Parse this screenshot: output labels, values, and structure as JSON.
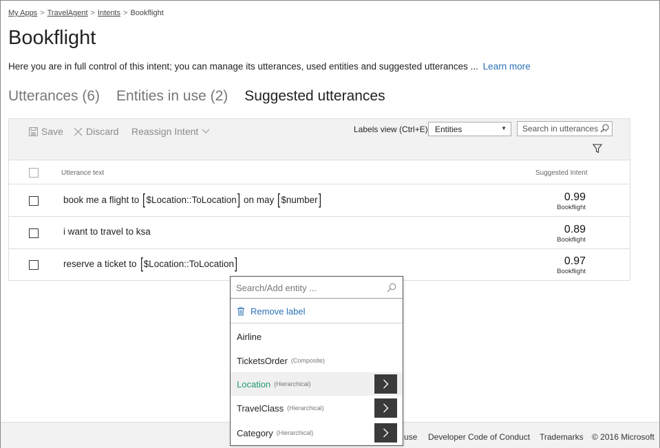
{
  "breadcrumb": [
    {
      "label": "My Apps",
      "link": true
    },
    {
      "label": "TravelAgent",
      "link": true
    },
    {
      "label": "Intents",
      "link": true
    },
    {
      "label": "Bookflight",
      "link": false
    }
  ],
  "page": {
    "title": "Bookflight",
    "description": "Here you are in full control of this intent; you can manage its utterances, used entities and suggested utterances ...",
    "learn_more": "Learn more"
  },
  "tabs": [
    {
      "label": "Utterances (6)",
      "active": false
    },
    {
      "label": "Entities in use (2)",
      "active": false
    },
    {
      "label": "Suggested utterances",
      "active": true
    }
  ],
  "toolbar": {
    "save": "Save",
    "discard": "Discard",
    "reassign": "Reassign Intent",
    "labels_view": "Labels view (Ctrl+E):",
    "labels_select": "Entities",
    "search_placeholder": "Search in utterances ..."
  },
  "table": {
    "col_utterance": "Utterance text",
    "col_intent": "Suggested Intent",
    "rows": [
      {
        "parts": [
          "book me a flight to",
          "$Location::ToLocation",
          "on may",
          "$number"
        ],
        "score": "0.99",
        "intent": "Bookflight"
      },
      {
        "parts": [
          "i want to travel to ksa"
        ],
        "score": "0.89",
        "intent": "Bookflight"
      },
      {
        "parts": [
          "reserve a ticket to",
          "$Location::ToLocation"
        ],
        "score": "0.97",
        "intent": "Bookflight"
      }
    ]
  },
  "dropdown": {
    "search_placeholder": "Search/Add entity ...",
    "remove_label": "Remove label",
    "items": [
      {
        "label": "Airline",
        "sub": "",
        "arrow": false,
        "highlighted": false
      },
      {
        "label": "TicketsOrder",
        "sub": "(Composite)",
        "arrow": false,
        "highlighted": false
      },
      {
        "label": "Location",
        "sub": "(Hierarchical)",
        "arrow": true,
        "highlighted": true
      },
      {
        "label": "TravelClass",
        "sub": "(Hierarchical)",
        "arrow": true,
        "highlighted": false
      },
      {
        "label": "Category",
        "sub": "(Hierarchical)",
        "arrow": true,
        "highlighted": false
      }
    ]
  },
  "footer": {
    "terms_partial": "use",
    "code_of_conduct": "Developer Code of Conduct",
    "trademarks": "Trademarks",
    "copyright": "© 2016 Microsoft"
  },
  "colors": {
    "link": "#2a6fb5",
    "highlight_text": "#1f9b6b",
    "arrow_button": "#3a3a3a"
  },
  "icons": [
    "save-icon",
    "close-icon",
    "chevron-down-icon",
    "search-icon",
    "filter-icon",
    "trash-icon",
    "chevron-right-icon"
  ]
}
